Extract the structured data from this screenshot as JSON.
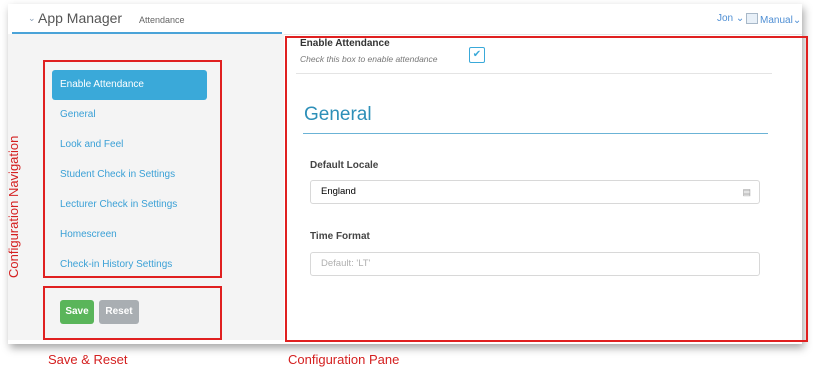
{
  "header": {
    "app_title": "App Manager",
    "section": "Attendance",
    "user": "Jon",
    "manual": "Manual"
  },
  "sidebar": {
    "items": [
      {
        "label": "Enable Attendance",
        "active": true
      },
      {
        "label": "General"
      },
      {
        "label": "Look and Feel"
      },
      {
        "label": "Student Check in Settings"
      },
      {
        "label": "Lecturer Check in Settings"
      },
      {
        "label": "Homescreen"
      },
      {
        "label": "Check-in History Settings"
      }
    ],
    "save_label": "Save",
    "reset_label": "Reset"
  },
  "pane": {
    "enable_title": "Enable Attendance",
    "enable_hint": "Check this box to enable attendance",
    "enable_checked": true,
    "section_heading": "General",
    "locale_label": "Default Locale",
    "locale_value": "England",
    "time_label": "Time Format",
    "time_placeholder": "Default: 'LT'"
  },
  "annotations": {
    "nav": "Configuration Navigation",
    "save_reset": "Save & Reset",
    "pane": "Configuration Pane"
  },
  "colors": {
    "accent": "#3aa9d9",
    "save": "#5ab55a",
    "reset": "#a9aeb2",
    "annotation": "#e02020"
  }
}
